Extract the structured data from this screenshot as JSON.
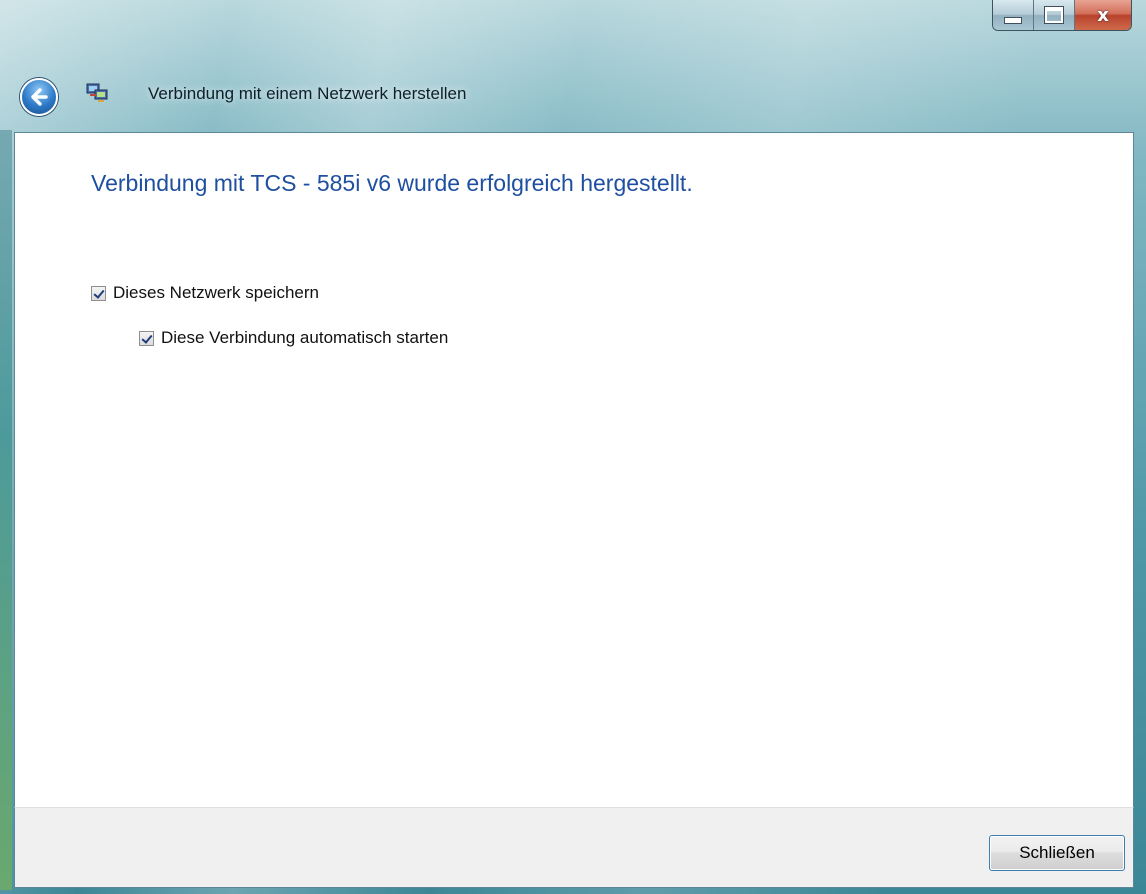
{
  "window": {
    "title": "Verbindung mit einem Netzwerk herstellen",
    "caption_buttons": {
      "minimize_icon": "minimize-icon",
      "maximize_icon": "maximize-icon",
      "close_glyph": "x"
    }
  },
  "nav": {
    "back_icon": "back-arrow-icon",
    "app_icon": "network-connect-icon"
  },
  "main": {
    "heading": "Verbindung mit TCS - 585i v6 wurde erfolgreich hergestellt.",
    "options": [
      {
        "label": "Dieses Netzwerk speichern",
        "checked": true
      },
      {
        "label": "Diese Verbindung automatisch starten",
        "checked": true
      }
    ]
  },
  "footer": {
    "close_label": "Schließen"
  },
  "colors": {
    "heading": "#1f4fa0",
    "frame": "#4f98a8",
    "close_accent": "#b8432c"
  }
}
